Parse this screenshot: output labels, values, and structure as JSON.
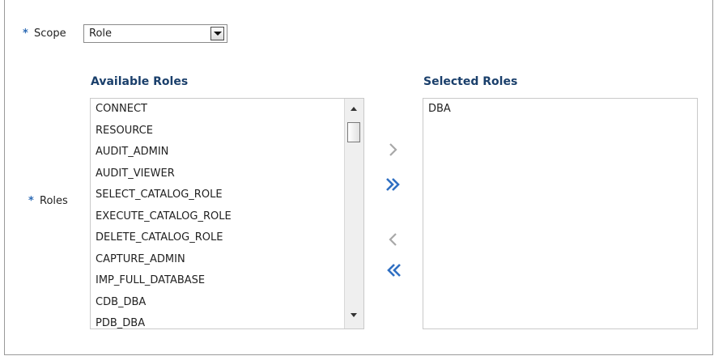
{
  "scope": {
    "required_marker": "*",
    "label": "Scope",
    "selected_value": "Role"
  },
  "roles": {
    "required_marker": "*",
    "label": "Roles"
  },
  "available": {
    "heading": "Available Roles",
    "items": [
      "CONNECT",
      "RESOURCE",
      "AUDIT_ADMIN",
      "AUDIT_VIEWER",
      "SELECT_CATALOG_ROLE",
      "EXECUTE_CATALOG_ROLE",
      "DELETE_CATALOG_ROLE",
      "CAPTURE_ADMIN",
      "IMP_FULL_DATABASE",
      "CDB_DBA",
      "PDB_DBA"
    ]
  },
  "selected": {
    "heading": "Selected Roles",
    "items": [
      "DBA"
    ]
  },
  "shuttle": {
    "move_icon": "chevron-right-icon",
    "move_all_icon": "double-chevron-right-icon",
    "remove_icon": "chevron-left-icon",
    "remove_all_icon": "double-chevron-left-icon"
  },
  "colors": {
    "required": "#2d6bb5",
    "heading": "#1a3f6b",
    "active_arrow": "#2f6fc2",
    "disabled_arrow": "#a8a8a8"
  }
}
